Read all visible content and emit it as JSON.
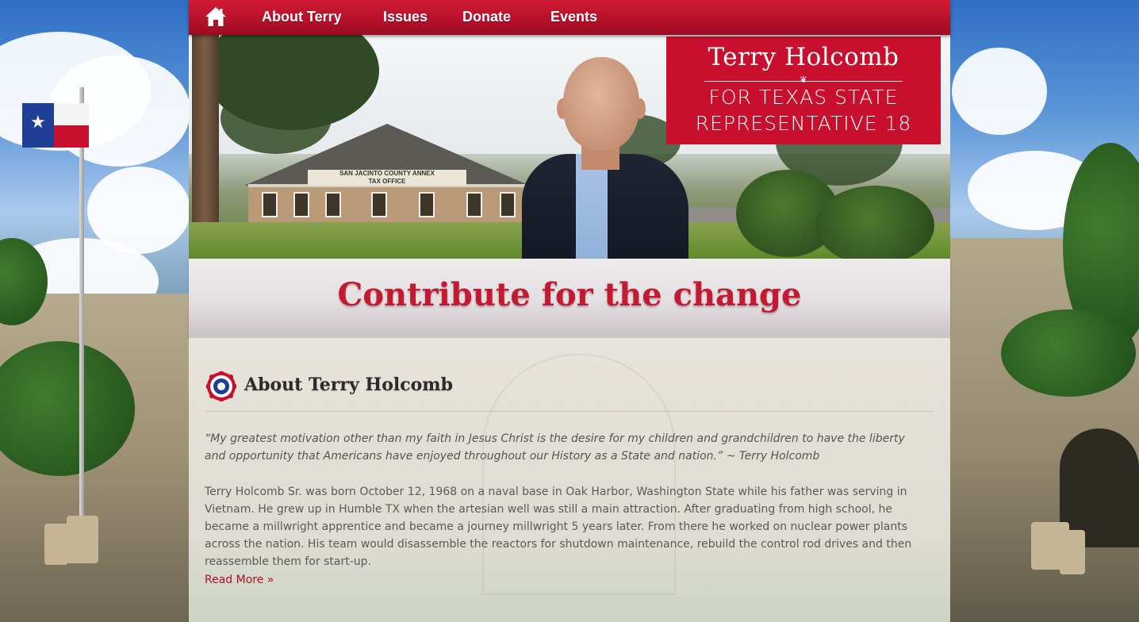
{
  "nav": {
    "home_icon": "home-icon",
    "items": [
      {
        "label": "About Terry"
      },
      {
        "label": "Issues"
      },
      {
        "label": "Donate"
      },
      {
        "label": "Events"
      }
    ]
  },
  "hero": {
    "name": "Terry Holcomb",
    "line1": "FOR TEXAS STATE",
    "line2": "REPRESENTATIVE 18",
    "building_sign": "SAN JACINTO COUNTY ANNEX",
    "building_sign_sub": "TAX OFFICE"
  },
  "banner": {
    "title": "Contribute for the change"
  },
  "about": {
    "icon": "rosette-icon",
    "title": "About Terry Holcomb",
    "quote": "“My greatest motivation other than my faith in Jesus Christ is the desire for my children and grandchildren to have the liberty and opportunity that Americans have enjoyed throughout our History as a State and nation.” ~ Terry Holcomb",
    "bio": "Terry Holcomb Sr. was born October 12, 1968 on a naval base in Oak Harbor, Washington State while his father was serving in Vietnam. He grew up in Humble TX when the artesian well was still a main attraction. After graduating from high school, he became a millwright apprentice and became a journey millwright 5 years later. From there he worked on nuclear power plants across the nation. His team would disassemble the reactors for shutdown maintenance, rebuild the control rod drives and then reassemble them for start-up.",
    "read_more": "Read More »"
  },
  "colors": {
    "brand_red": "#c8102e",
    "title_red": "#c31932",
    "link_red": "#b01024"
  }
}
